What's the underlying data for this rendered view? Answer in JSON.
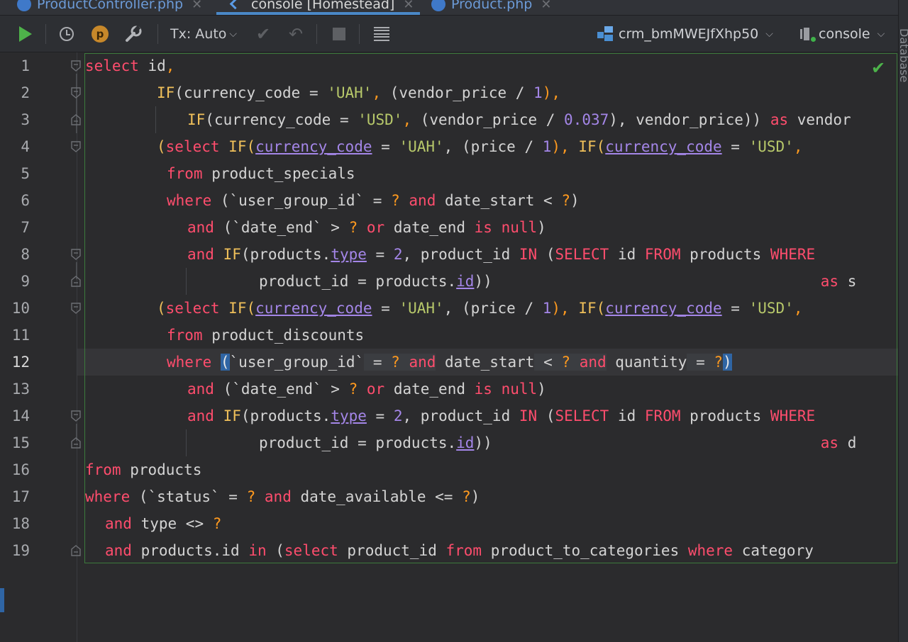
{
  "tabs": [
    {
      "label": "ProductController.php",
      "active": false
    },
    {
      "label": "console [Homestead]",
      "active": true
    },
    {
      "label": "Product.php",
      "active": false
    }
  ],
  "right_panel_label": "Database",
  "toolbar": {
    "run_icon": "play-icon",
    "history_icon": "clock-icon",
    "profile_badge": "p",
    "settings_icon": "wrench-icon",
    "tx_mode": "Tx: Auto",
    "datasource": "crm_bmMWEJfXhp50",
    "session": "console"
  },
  "editor": {
    "line_numbers": [
      "1",
      "2",
      "3",
      "4",
      "5",
      "6",
      "7",
      "8",
      "9",
      "10",
      "11",
      "12",
      "13",
      "14",
      "15",
      "16",
      "17",
      "18",
      "19"
    ],
    "current_line": "12"
  },
  "colors": {
    "keyword": "#ff4d6d",
    "function": "#f0c05a",
    "string": "#b7c86a",
    "number": "#a486e8",
    "placeholder": "#ff9a1f",
    "accent": "#4a88c7",
    "run": "#4eb24a"
  },
  "code": {
    "l1": {
      "t1": "select",
      "t2": " id",
      ",": ","
    },
    "l2": {
      "t1": "IF",
      "t2": "(currency_code = ",
      "t3": "'UAH'",
      "t4": ", ",
      "t5": "(vendor_price / ",
      "t6": "1",
      "t7": "),"
    },
    "l3": {
      "t1": "IF",
      "t2": "(currency_code = ",
      "t3": "'USD'",
      "t4": ", ",
      "t5": "(vendor_price / ",
      "t6": "0.037",
      "t7": "), vendor_price)) ",
      "t8": "as",
      "t9": " vendor"
    },
    "l4": {
      "t1": "(",
      "t2": "select",
      "t3": " ",
      "t4": "IF",
      "t5": "(",
      "t6": "currency_code",
      "t7": " = ",
      "t8": "'UAH'",
      "t9": ", (price / ",
      "t10": "1",
      "t11": "), ",
      "t12": "IF",
      "t13": "(",
      "t14": "currency_code",
      "t15": " = ",
      "t16": "'USD'",
      "t17": ","
    },
    "l5": {
      "t1": "from",
      "t2": " product_specials"
    },
    "l6": {
      "t1": "where",
      "t2": " (`user_group_id` = ",
      "t3": "?",
      "t4": " ",
      "t5": "and",
      "t6": " date_start < ",
      "t7": "?",
      "t8": ")"
    },
    "l7": {
      "t1": "and",
      "t2": " (`date_end` > ",
      "t3": "?",
      "t4": " ",
      "t5": "or",
      "t6": " date_end ",
      "t7": "is",
      "t8": " ",
      "t9": "null",
      "t10": ")"
    },
    "l8": {
      "t1": "and",
      "t2": " ",
      "t3": "IF",
      "t4": "(products.",
      "t5": "type",
      "t6": " = ",
      "t7": "2",
      "t8": ", product_id ",
      "t9": "IN",
      "t10": " (",
      "t11": "SELECT",
      "t12": " id ",
      "t13": "FROM",
      "t14": " products ",
      "t15": "WHERE"
    },
    "l9": {
      "t1": "product_id = products.",
      "t2": "id",
      "t3": "))",
      "t4": "as",
      "t5": " s"
    },
    "l10": {
      "t1": "(",
      "t2": "select",
      "t3": " ",
      "t4": "IF",
      "t5": "(",
      "t6": "currency_code",
      "t7": " = ",
      "t8": "'UAH'",
      "t9": ", (price / ",
      "t10": "1",
      "t11": "), ",
      "t12": "IF",
      "t13": "(",
      "t14": "currency_code",
      "t15": " = ",
      "t16": "'USD'",
      "t17": ","
    },
    "l11": {
      "t1": "from",
      "t2": " product_discounts"
    },
    "l12": {
      "t1": "where",
      "t2": " ",
      "t3": "(",
      "t4": "`user_group_id`",
      "t5": " = ",
      "t6": "?",
      "t7": " ",
      "t8": "and",
      "t9": " date_start",
      "t10": " < ",
      "t11": "?",
      "t12": " ",
      "t13": "and",
      "t14": " quantity",
      "t15": " = ",
      "t16": "?",
      "t17": ")"
    },
    "l13": {
      "t1": "and",
      "t2": " (`date_end` > ",
      "t3": "?",
      "t4": " ",
      "t5": "or",
      "t6": " date_end ",
      "t7": "is",
      "t8": " ",
      "t9": "null",
      "t10": ")"
    },
    "l14": {
      "t1": "and",
      "t2": " ",
      "t3": "IF",
      "t4": "(products.",
      "t5": "type",
      "t6": " = ",
      "t7": "2",
      "t8": ", product_id ",
      "t9": "IN",
      "t10": " (",
      "t11": "SELECT",
      "t12": " id ",
      "t13": "FROM",
      "t14": " products ",
      "t15": "WHERE"
    },
    "l15": {
      "t1": "product_id = products.",
      "t2": "id",
      "t3": "))",
      "t4": "as",
      "t5": " d"
    },
    "l16": {
      "t1": "from",
      "t2": " products"
    },
    "l17": {
      "t1": "where",
      "t2": " (`status` = ",
      "t3": "?",
      "t4": " ",
      "t5": "and",
      "t6": " date_available <= ",
      "t7": "?",
      "t8": ")"
    },
    "l18": {
      "t1": "and",
      "t2": " type <> ",
      "t3": "?"
    },
    "l19": {
      "t1": "and",
      "t2": " products.id ",
      "t3": "in",
      "t4": " (",
      "t5": "select",
      "t6": " product_id ",
      "t7": "from",
      "t8": " product_to_categories ",
      "t9": "where",
      "t10": " category"
    }
  }
}
